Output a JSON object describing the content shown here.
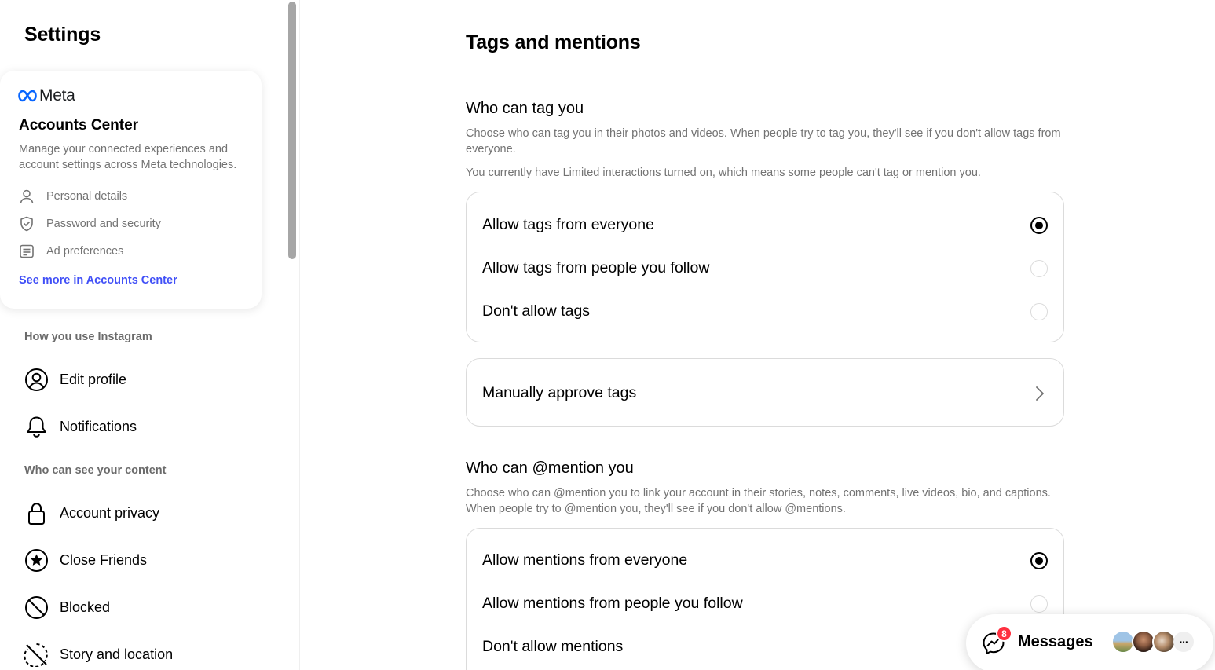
{
  "sidebar": {
    "title": "Settings",
    "accounts_center": {
      "brand": "Meta",
      "title": "Accounts Center",
      "description": "Manage your connected experiences and account settings across Meta technologies.",
      "links": [
        {
          "label": "Personal details",
          "icon": "person-icon"
        },
        {
          "label": "Password and security",
          "icon": "shield-check-icon"
        },
        {
          "label": "Ad preferences",
          "icon": "ad-icon"
        }
      ],
      "see_more": "See more in Accounts Center"
    },
    "sections": [
      {
        "label": "How you use Instagram"
      },
      {
        "label": "Who can see your content"
      }
    ],
    "items": [
      {
        "label": "Edit profile",
        "icon": "profile-circle-icon"
      },
      {
        "label": "Notifications",
        "icon": "bell-icon"
      },
      {
        "label": "Account privacy",
        "icon": "lock-icon"
      },
      {
        "label": "Close Friends",
        "icon": "star-circle-icon"
      },
      {
        "label": "Blocked",
        "icon": "blocked-icon"
      },
      {
        "label": "Story and location",
        "icon": "story-off-icon"
      }
    ]
  },
  "main": {
    "title": "Tags and mentions",
    "tags": {
      "heading": "Who can tag you",
      "description": "Choose who can tag you in their photos and videos. When people try to tag you, they'll see if you don't allow tags from everyone.",
      "notice": "You currently have Limited interactions turned on, which means some people can't tag or mention you.",
      "options": [
        {
          "label": "Allow tags from everyone",
          "selected": true
        },
        {
          "label": "Allow tags from people you follow",
          "selected": false
        },
        {
          "label": "Don't allow tags",
          "selected": false
        }
      ],
      "manual_approve": "Manually approve tags"
    },
    "mentions": {
      "heading": "Who can @mention you",
      "description": "Choose who can @mention you to link your account in their stories, notes, comments, live videos, bio, and captions. When people try to @mention you, they'll see if you don't allow @mentions.",
      "options": [
        {
          "label": "Allow mentions from everyone",
          "selected": true
        },
        {
          "label": "Allow mentions from people you follow",
          "selected": false
        },
        {
          "label": "Don't allow mentions",
          "selected": false
        }
      ]
    }
  },
  "messages": {
    "label": "Messages",
    "unread_count": "8",
    "more": "···"
  }
}
